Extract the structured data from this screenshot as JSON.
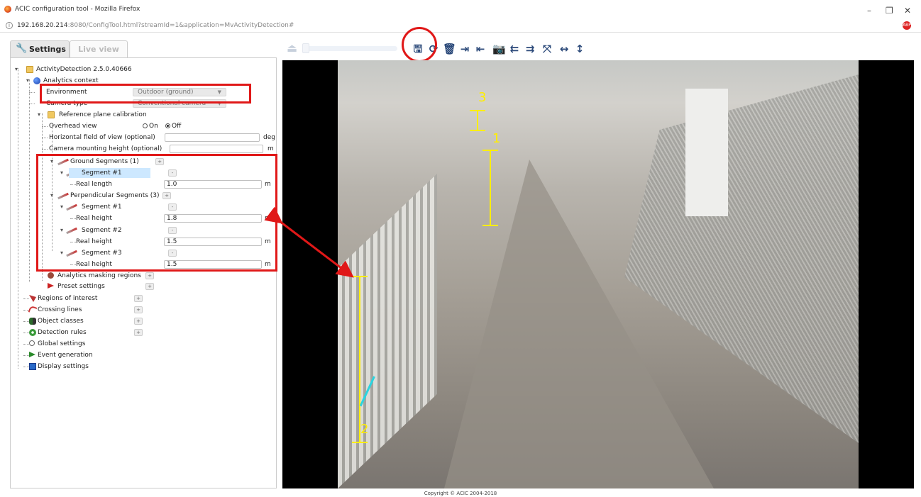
{
  "window": {
    "title": "ACIC configuration tool - Mozilla Firefox",
    "minimize": "–",
    "maximize": "❐",
    "close": "✕"
  },
  "address": {
    "host": "192.168.20.214",
    "path": ":8080/ConfigTool.html?streamId=1&application=MvActivityDetection#"
  },
  "tabs": {
    "settings": "Settings",
    "live": "Live view"
  },
  "tree": {
    "root": "ActivityDetection 2.5.0.40666",
    "analytics_context": "Analytics context",
    "environment_label": "Environment",
    "environment_value": "Outdoor (ground)",
    "camera_type_label": "Camera type",
    "camera_type_value": "Conventional camera",
    "ref_plane": "Reference plane calibration",
    "overhead_view": "Overhead view",
    "overhead_on": "On",
    "overhead_off": "Off",
    "hfov_label": "Horizontal field of view (optional)",
    "hfov_value": "",
    "hfov_unit": "deg",
    "mount_label": "Camera mounting height (optional)",
    "mount_value": "",
    "mount_unit": "m",
    "ground_segments": "Ground Segments (1)",
    "segment1": "Segment #1",
    "real_length_label": "Real length",
    "real_length_value": "1.0",
    "perp_segments": "Perpendicular Segments (3)",
    "perp_seg1": "Segment #1",
    "real_height_label": "Real height",
    "real_height_1": "1.8",
    "perp_seg2": "Segment #2",
    "real_height_2": "1.5",
    "perp_seg3": "Segment #3",
    "real_height_3": "1.5",
    "unit_m": "m",
    "masking": "Analytics masking regions",
    "preset": "Preset settings",
    "roi": "Regions of interest",
    "crossing": "Crossing lines",
    "object_classes": "Object classes",
    "detection_rules": "Detection rules",
    "global": "Global settings",
    "event_gen": "Event generation",
    "display": "Display settings",
    "plus": "+",
    "minus": "-"
  },
  "video": {
    "label_1": "1",
    "label_2": "2",
    "label_3": "3"
  },
  "footer": {
    "copyright": "Copyright © ACIC 2004-2018"
  },
  "colors": {
    "highlight_red": "#e01818",
    "measure_yellow": "#ffee00",
    "measure_cyan": "#2ad4e0",
    "toolbar_icon": "#2c4a7a"
  }
}
